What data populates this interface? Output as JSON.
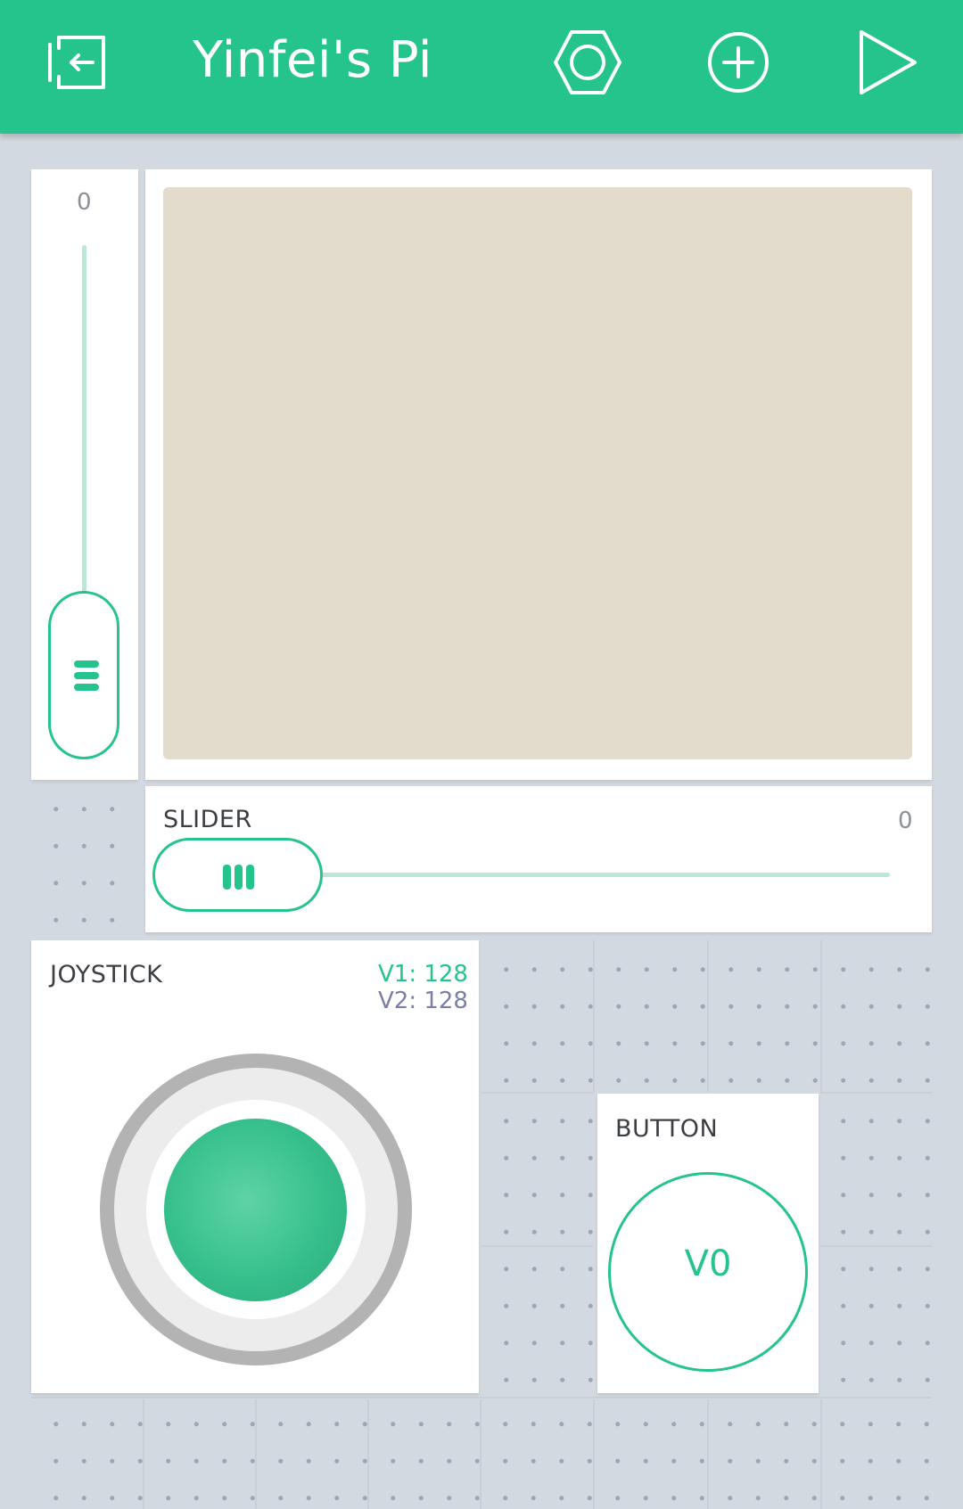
{
  "header": {
    "title": "Yinfei's Pi",
    "icons": {
      "back": "exit-icon",
      "settings": "hex-nut-icon",
      "add": "plus-circle-icon",
      "play": "play-icon"
    },
    "background_color": "#26c48d"
  },
  "widgets": {
    "vertical_slider": {
      "value": "0",
      "level": 0
    },
    "video_stream": {
      "screen_color": "#e3dccc"
    },
    "slider": {
      "label": "SLIDER",
      "value": "0",
      "level": 0
    },
    "joystick": {
      "label": "JOYSTICK",
      "v1": "V1: 128",
      "v2": "V2: 128",
      "v1_color": "#26c48d",
      "v2_color": "#7b7fa3"
    },
    "button": {
      "label": "BUTTON",
      "pin": "V0"
    }
  },
  "colors": {
    "accent": "#26c48d",
    "canvas": "#d3d9e0",
    "track": "#bde6d5"
  }
}
